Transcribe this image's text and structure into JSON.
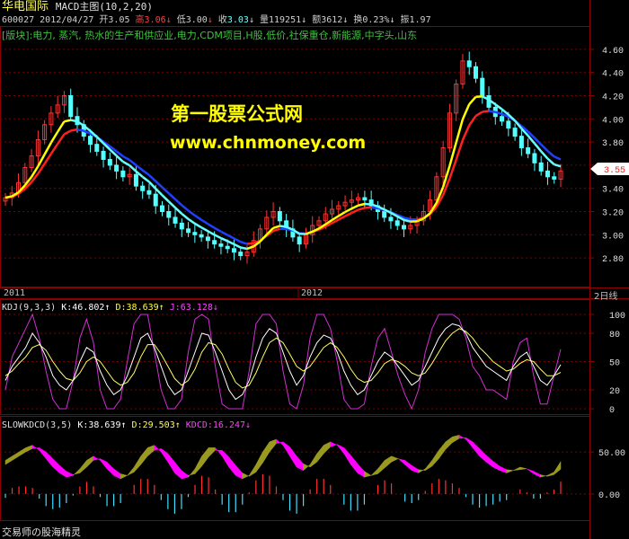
{
  "header": {
    "stock_name": "华电国际",
    "indicator": "MACD主图(10,2,20)",
    "code": "600027",
    "date": "2012/04/27",
    "open_label": "开",
    "open": "3.05",
    "high_label": "高",
    "high": "3.06",
    "low_label": "低",
    "low": "3.00",
    "close_label": "收",
    "close": "3.03",
    "volume_label": "量",
    "volume": "119251",
    "amount_label": "额",
    "amount": "3612",
    "turnover_label": "换",
    "turnover": "0.23%",
    "amplitude_label": "振",
    "amplitude": "1.97",
    "sectors": "[版块]:电力, 蒸汽, 热水的生产和供应业,电力,CDM项目,H股,低价,社保重仓,新能源,中字头,山东",
    "watermark_title": "第一股票公式网",
    "watermark_url": "www.chnmoney.com"
  },
  "price_axis": {
    "ticks": [
      "4.60",
      "4.40",
      "4.20",
      "4.00",
      "3.80",
      "3.60",
      "3.40",
      "3.20",
      "3.00",
      "2.80"
    ],
    "current_price": "3.55"
  },
  "time_axis": {
    "labels": [
      "2011",
      "2012"
    ],
    "period": "2日线"
  },
  "kdj": {
    "title": "KDJ(9,3,3)",
    "k_label": "K:46.802",
    "d_label": "D:38.639",
    "j_label": "J:63.128",
    "ticks": [
      "100",
      "80",
      "50",
      "20",
      "0"
    ]
  },
  "slowkdcd": {
    "title": "SLOWKDCD(3,5)",
    "k_label": "K:38.639",
    "d_label": "D:29.503",
    "kdcd_label": "KDCD:16.247",
    "ticks": [
      "50.00",
      "0.00"
    ]
  },
  "footer": {
    "caption": "交易师の股海精灵"
  },
  "colors": {
    "up": "#ff3333",
    "down": "#54ffff",
    "yellow_line": "#ffff00",
    "red_line": "#ff2020",
    "blue_line": "#2040ff",
    "cyan_line": "#66ffff",
    "watermark": "#ffff00",
    "magenta": "#ff00ff",
    "olive": "#9a9a20"
  },
  "chart_data": [
    {
      "type": "candlestick",
      "title": "华电国际 MACD主图(10,2,20)",
      "ylim": [
        2.7,
        4.7
      ],
      "x_labels": [
        "2011",
        "2012"
      ],
      "closes": [
        3.32,
        3.36,
        3.45,
        3.58,
        3.68,
        3.82,
        3.95,
        4.05,
        4.12,
        4.2,
        4.02,
        3.95,
        3.85,
        3.78,
        3.72,
        3.65,
        3.6,
        3.55,
        3.5,
        3.52,
        3.42,
        3.38,
        3.35,
        3.25,
        3.2,
        3.15,
        3.1,
        3.05,
        3.02,
        3.0,
        2.98,
        2.95,
        2.92,
        2.9,
        2.88,
        2.85,
        2.82,
        2.85,
        2.95,
        3.05,
        3.15,
        3.2,
        3.12,
        3.05,
        2.98,
        2.92,
        3.0,
        3.08,
        3.12,
        3.18,
        3.22,
        3.25,
        3.28,
        3.3,
        3.32,
        3.3,
        3.25,
        3.2,
        3.15,
        3.12,
        3.08,
        3.05,
        3.08,
        3.12,
        3.2,
        3.3,
        3.5,
        3.75,
        4.05,
        4.3,
        4.5,
        4.45,
        4.35,
        4.2,
        4.1,
        4.02,
        3.98,
        3.92,
        3.85,
        3.75,
        3.7,
        3.62,
        3.55,
        3.5,
        3.48,
        3.55
      ]
    },
    {
      "type": "line",
      "title": "KDJ(9,3,3)",
      "ylim": [
        0,
        100
      ],
      "series": [
        {
          "name": "K",
          "values": [
            30,
            45,
            55,
            65,
            80,
            70,
            55,
            35,
            25,
            20,
            30,
            50,
            65,
            60,
            40,
            25,
            15,
            20,
            35,
            55,
            75,
            80,
            65,
            45,
            25,
            15,
            20,
            40,
            60,
            80,
            78,
            60,
            40,
            20,
            10,
            15,
            30,
            55,
            75,
            85,
            80,
            60,
            40,
            25,
            35,
            55,
            70,
            78,
            75,
            60,
            40,
            25,
            15,
            20,
            35,
            50,
            60,
            55,
            45,
            35,
            25,
            30,
            45,
            60,
            75,
            85,
            90,
            88,
            80,
            65,
            55,
            45,
            40,
            35,
            30,
            45,
            55,
            60,
            45,
            30,
            25,
            35,
            46.8
          ]
        },
        {
          "name": "D",
          "values": [
            35,
            40,
            48,
            55,
            65,
            68,
            62,
            50,
            40,
            32,
            30,
            38,
            50,
            55,
            50,
            40,
            30,
            25,
            28,
            38,
            55,
            68,
            68,
            58,
            45,
            32,
            25,
            30,
            42,
            60,
            70,
            68,
            58,
            42,
            28,
            22,
            25,
            38,
            55,
            70,
            75,
            70,
            58,
            45,
            40,
            45,
            55,
            65,
            70,
            65,
            55,
            42,
            32,
            28,
            30,
            38,
            48,
            52,
            50,
            45,
            38,
            35,
            38,
            48,
            60,
            72,
            80,
            85,
            82,
            75,
            65,
            58,
            50,
            45,
            40,
            42,
            48,
            52,
            50,
            42,
            35,
            35,
            38.6
          ]
        },
        {
          "name": "J",
          "values": [
            20,
            55,
            70,
            85,
            100,
            75,
            40,
            10,
            0,
            0,
            30,
            75,
            95,
            70,
            20,
            0,
            0,
            10,
            50,
            90,
            100,
            100,
            60,
            20,
            0,
            0,
            10,
            60,
            95,
            100,
            95,
            45,
            5,
            0,
            0,
            0,
            40,
            90,
            100,
            100,
            90,
            40,
            5,
            0,
            25,
            75,
            100,
            100,
            85,
            50,
            10,
            0,
            0,
            5,
            45,
            75,
            85,
            60,
            35,
            15,
            0,
            20,
            60,
            85,
            100,
            100,
            100,
            95,
            75,
            45,
            35,
            20,
            20,
            15,
            10,
            50,
            70,
            75,
            35,
            5,
            5,
            35,
            63.1
          ]
        }
      ]
    },
    {
      "type": "area",
      "title": "SLOWKDCD(3,5)",
      "ylim": [
        -30,
        80
      ],
      "series": [
        {
          "name": "K",
          "values": [
            40,
            45,
            50,
            55,
            58,
            52,
            42,
            32,
            25,
            20,
            22,
            30,
            40,
            45,
            40,
            30,
            22,
            18,
            22,
            32,
            45,
            55,
            58,
            50,
            38,
            25,
            18,
            20,
            30,
            45,
            55,
            55,
            45,
            32,
            22,
            18,
            22,
            35,
            50,
            62,
            65,
            58,
            45,
            32,
            28,
            35,
            48,
            58,
            62,
            58,
            48,
            35,
            25,
            20,
            22,
            30,
            40,
            45,
            42,
            35,
            28,
            25,
            30,
            40,
            52,
            62,
            68,
            70,
            65,
            55,
            45,
            38,
            32,
            28,
            25,
            28,
            32,
            30,
            24,
            20,
            22,
            26,
            38.6
          ]
        },
        {
          "name": "D",
          "values": [
            35,
            40,
            45,
            50,
            54,
            55,
            50,
            42,
            34,
            27,
            23,
            25,
            32,
            40,
            42,
            38,
            30,
            24,
            22,
            26,
            35,
            45,
            52,
            54,
            48,
            38,
            28,
            22,
            24,
            33,
            44,
            52,
            52,
            44,
            34,
            25,
            21,
            26,
            37,
            50,
            60,
            62,
            56,
            45,
            36,
            32,
            38,
            48,
            56,
            59,
            55,
            46,
            36,
            27,
            22,
            24,
            31,
            38,
            42,
            40,
            34,
            29,
            28,
            33,
            42,
            53,
            61,
            66,
            67,
            62,
            54,
            46,
            39,
            33,
            29,
            28,
            29,
            30,
            27,
            23,
            21,
            23,
            29.5
          ]
        },
        {
          "name": "KDCD",
          "values": [
            -5,
            8,
            10,
            10,
            8,
            -6,
            -16,
            -20,
            -18,
            -12,
            -2,
            10,
            16,
            10,
            -4,
            -16,
            -16,
            -12,
            0,
            12,
            20,
            20,
            12,
            -8,
            -20,
            -26,
            -20,
            -4,
            12,
            24,
            22,
            6,
            -14,
            -24,
            -24,
            -14,
            2,
            18,
            26,
            24,
            10,
            -8,
            -22,
            -26,
            -16,
            6,
            20,
            20,
            12,
            0,
            -14,
            -22,
            -22,
            -14,
            0,
            12,
            18,
            14,
            0,
            -10,
            -12,
            -8,
            4,
            14,
            20,
            18,
            14,
            8,
            -4,
            -14,
            -18,
            -16,
            -14,
            -10,
            -8,
            0,
            6,
            2,
            -6,
            -6,
            2,
            6,
            16.2
          ]
        }
      ]
    }
  ]
}
